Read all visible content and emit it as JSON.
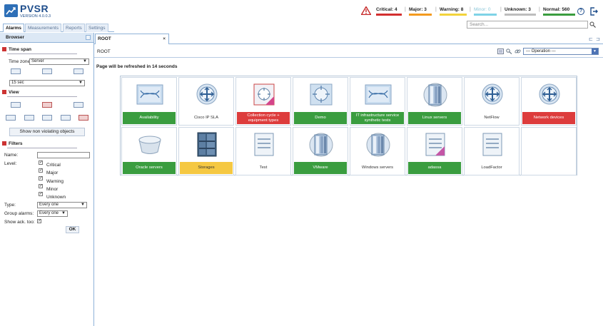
{
  "app": {
    "title": "PVSR",
    "version": "VERSION 4.0.0.3"
  },
  "status": {
    "critical": {
      "label": "Critical: 4",
      "color": "#d32f2f"
    },
    "major": {
      "label": "Major: 3",
      "color": "#f39a1e"
    },
    "warning": {
      "label": "Warning: 8",
      "color": "#f2d33b"
    },
    "minor": {
      "label": "Minor: 0",
      "color": "#7fd3e6"
    },
    "unknown": {
      "label": "Unknown: 3",
      "color": "#bdbdbd"
    },
    "normal": {
      "label": "Normal: 560",
      "color": "#3a9d3f"
    }
  },
  "search": {
    "placeholder": "Search..."
  },
  "left_tabs": [
    "Alarms",
    "Measurements",
    "Reports",
    "Settings"
  ],
  "browser": {
    "title": "Browser"
  },
  "time_span": {
    "title": "Time span",
    "timezone_label": "Time zone:",
    "timezone_value": "Server",
    "refresh_value": "15 sec"
  },
  "view": {
    "title": "View",
    "show_button": "Show non violating objects"
  },
  "filters": {
    "title": "Filters",
    "name_label": "Name:",
    "level_label": "Level:",
    "levels": [
      "Critical",
      "Major",
      "Warning",
      "Minor",
      "Unknown"
    ],
    "type_label": "Type:",
    "type_value": "Every one",
    "group_label": "Group alarms:",
    "group_value": "Every one",
    "showack_label": "Show ack. too:",
    "ok_button": "OK"
  },
  "main": {
    "tab_label": "ROOT",
    "breadcrumb": "ROOT",
    "operation_placeholder": "--- Operation ---",
    "refresh_text": "Page will be refreshed in 14 seconds"
  },
  "tiles": [
    {
      "label": "Availability",
      "status": "green",
      "icon": "network-map-icon"
    },
    {
      "label": "Cisco IP SLA",
      "status": "plain",
      "icon": "router-icon"
    },
    {
      "label": "Collection cycle + equipment types",
      "status": "red",
      "icon": "folder-alert-icon"
    },
    {
      "label": "Demo",
      "status": "green",
      "icon": "router-box-icon"
    },
    {
      "label": "IT infrastructure service synthetic tests",
      "status": "green",
      "icon": "network-map-icon"
    },
    {
      "label": "Linux servers",
      "status": "green",
      "icon": "server-icon"
    },
    {
      "label": "NetFlow",
      "status": "plain",
      "icon": "router-icon"
    },
    {
      "label": "Network devices",
      "status": "red",
      "icon": "router-icon"
    },
    {
      "label": "Oracle servers",
      "status": "green",
      "icon": "database-icon"
    },
    {
      "label": "Storages",
      "status": "yellow",
      "icon": "storage-icon"
    },
    {
      "label": "Test",
      "status": "plain",
      "icon": "document-icon"
    },
    {
      "label": "VMware",
      "status": "green",
      "icon": "server-icon"
    },
    {
      "label": "Windows servers",
      "status": "plain",
      "icon": "server-icon"
    },
    {
      "label": "adassa",
      "status": "green",
      "icon": "document-alert-icon"
    },
    {
      "label": "LoadFactor",
      "status": "plain",
      "icon": "document-icon"
    }
  ]
}
